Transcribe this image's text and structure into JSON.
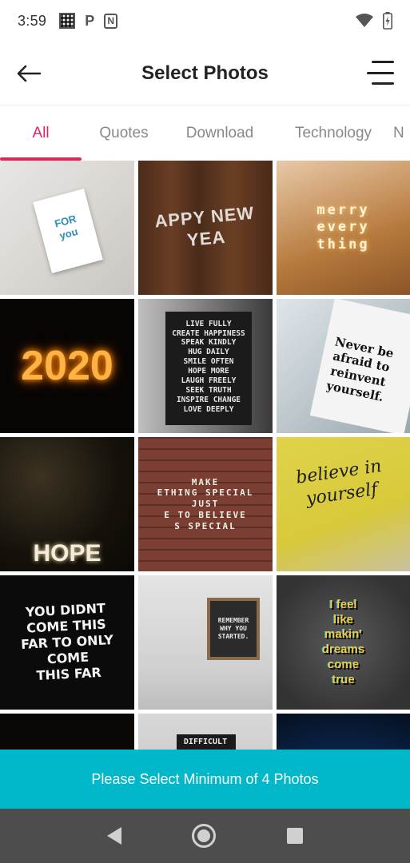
{
  "status_bar": {
    "time": "3:59",
    "left_icons": [
      "qr-code-icon",
      "p-icon",
      "nfc-icon"
    ],
    "p_glyph": "P",
    "n_glyph": "N",
    "right_icons": [
      "wifi-icon",
      "battery-icon"
    ]
  },
  "app_bar": {
    "title": "Select Photos",
    "back_icon": "arrow-left-icon",
    "menu_icon": "hamburger-menu-icon"
  },
  "tabs": [
    {
      "label": "All",
      "active": true
    },
    {
      "label": "Quotes",
      "active": false
    },
    {
      "label": "Download",
      "active": false
    },
    {
      "label": "Technology",
      "active": false
    },
    {
      "label": "N",
      "active": false
    }
  ],
  "photos": [
    {
      "caption": "FOR\nyou"
    },
    {
      "caption": "APPY NEW YEA"
    },
    {
      "caption": "merry\nevery\nthing"
    },
    {
      "caption": "2020"
    },
    {
      "caption": "LIVE FULLY\nCREATE HAPPINESS\nSPEAK KINDLY\nHUG DAILY\nSMILE OFTEN\nHOPE MORE\nLAUGH FREELY\nSEEK TRUTH\nINSPIRE CHANGE\nLOVE DEEPLY"
    },
    {
      "caption": "Never be\nafraid to\nreinvent\nyourself."
    },
    {
      "caption": "HOPE"
    },
    {
      "caption": "MAKE\nETHING SPECIAL\nJUST\nE TO BELIEVE\nS SPECIAL"
    },
    {
      "caption": "believe in yourself"
    },
    {
      "caption": "YOU DIDNT COME THIS\nFAR TO ONLY COME\nTHIS FAR"
    },
    {
      "caption": "REMEMBER\nWHY YOU\nSTARTED."
    },
    {
      "caption": "I feel\nlike\nmakin'\ndreams\ncome\ntrue"
    },
    {
      "caption": ""
    },
    {
      "caption": "DIFFICULT"
    },
    {
      "caption": ""
    }
  ],
  "action_bar": {
    "label": "Please Select Minimum of 4 Photos",
    "color": "#00b8c9"
  },
  "nav_bar": {
    "icons": [
      "nav-back-icon",
      "nav-home-icon",
      "nav-recents-icon"
    ]
  },
  "colors": {
    "accent": "#e8235a",
    "action": "#00b8c9",
    "nav_bg": "#4d4d4d"
  }
}
